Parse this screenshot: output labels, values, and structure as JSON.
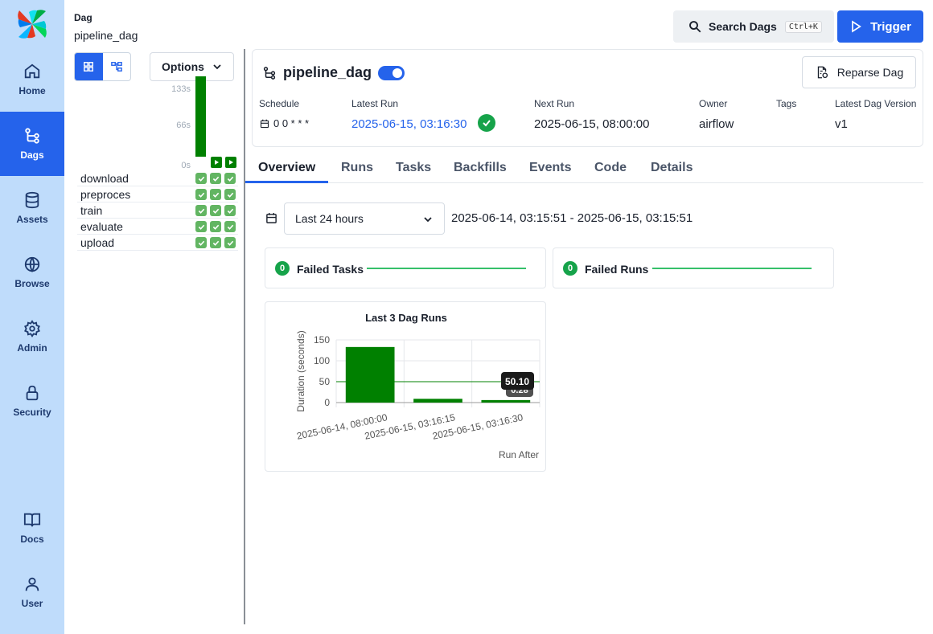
{
  "nav": {
    "items": [
      {
        "label": "Home",
        "icon": "home-icon"
      },
      {
        "label": "Dags",
        "icon": "dags-icon"
      },
      {
        "label": "Assets",
        "icon": "database-icon"
      },
      {
        "label": "Browse",
        "icon": "globe-icon"
      },
      {
        "label": "Admin",
        "icon": "gear-icon"
      },
      {
        "label": "Security",
        "icon": "lock-icon"
      },
      {
        "label": "Docs",
        "icon": "book-icon"
      },
      {
        "label": "User",
        "icon": "user-icon"
      }
    ],
    "active": "Dags"
  },
  "breadcrumb": {
    "label": "Dag",
    "value": "pipeline_dag"
  },
  "header": {
    "search_label": "Search Dags",
    "search_shortcut": "Ctrl+K",
    "trigger_label": "Trigger"
  },
  "grid": {
    "options_label": "Options",
    "axis": [
      "133s",
      "66s",
      "0s"
    ],
    "run_fill": [
      1.0,
      0.0,
      0.0
    ],
    "tasks": [
      "download",
      "preproces",
      "train",
      "evaluate",
      "upload"
    ],
    "status": "success"
  },
  "dag": {
    "name": "pipeline_dag",
    "paused": false,
    "reparse_label": "Reparse Dag",
    "meta": {
      "schedule_label": "Schedule",
      "schedule_value": "0 0 * * *",
      "latest_run_label": "Latest Run",
      "latest_run_value": "2025-06-15, 03:16:30",
      "next_run_label": "Next Run",
      "next_run_value": "2025-06-15, 08:00:00",
      "owner_label": "Owner",
      "owner_value": "airflow",
      "tags_label": "Tags",
      "version_label": "Latest Dag Version",
      "version_value": "v1"
    }
  },
  "tabs": [
    "Overview",
    "Runs",
    "Tasks",
    "Backfills",
    "Events",
    "Code",
    "Details"
  ],
  "active_tab": "Overview",
  "filter": {
    "range_label": "Last 24 hours",
    "range_text": "2025-06-14, 03:15:51 - 2025-06-15, 03:15:51"
  },
  "stats": {
    "failed_tasks": {
      "count": "0",
      "label": "Failed Tasks"
    },
    "failed_runs": {
      "count": "0",
      "label": "Failed Runs"
    }
  },
  "colors": {
    "accent": "#2563eb",
    "success": "#008000",
    "badge": "#16a34a",
    "sidebar": "#bfdcfb"
  },
  "chart_data": {
    "type": "bar",
    "title": "Last 3 Dag Runs",
    "xlabel": "Run After",
    "ylabel": "Duration (seconds)",
    "categories": [
      "2025-06-14, 08:00:00",
      "2025-06-15, 03:16:15",
      "2025-06-15, 03:16:30"
    ],
    "values": [
      133,
      9,
      6
    ],
    "ylim": [
      0,
      150
    ],
    "yticks": [
      0,
      50,
      100,
      150
    ],
    "mean_line": 50.1,
    "tooltip_labels": [
      "50.10",
      "0.28"
    ],
    "grid": true
  }
}
